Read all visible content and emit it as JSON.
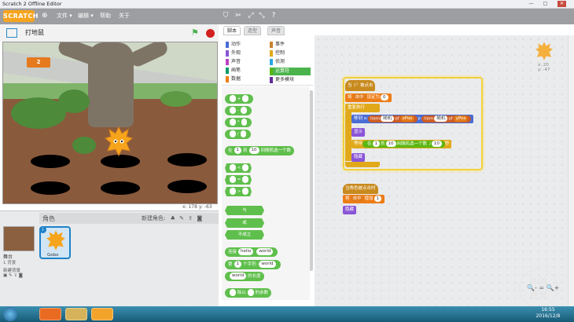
{
  "window": {
    "title": "Scratch 2 Offline Editor",
    "min": "—",
    "max": "□",
    "close": "✕"
  },
  "menubar": {
    "logo": "SCRATCH",
    "items": [
      "文件 ▾",
      "编辑 ▾",
      "帮助",
      "关于"
    ],
    "tools": [
      "duplicate-icon",
      "delete-icon",
      "grow-icon",
      "shrink-icon",
      "help-icon"
    ]
  },
  "stage": {
    "project_name": "打地鼠",
    "score": "2",
    "coords": "x: 178  y: -63"
  },
  "sprites": {
    "header": "角色",
    "new_sprite": "新建角色:",
    "stage_label": "舞台",
    "stage_sub": "1 背景",
    "new_backdrop": "新建背景",
    "sprite_name": "Gobo"
  },
  "tabs": [
    "脚本",
    "造型",
    "声音"
  ],
  "categories": [
    {
      "label": "动作",
      "color": "#4a6cd4"
    },
    {
      "label": "外观",
      "color": "#8a55d7"
    },
    {
      "label": "声音",
      "color": "#bb42c3"
    },
    {
      "label": "画笔",
      "color": "#0e9a6c"
    },
    {
      "label": "数据",
      "color": "#ee7d16"
    },
    {
      "label": "事件",
      "color": "#c88330"
    },
    {
      "label": "控制",
      "color": "#e1a91a"
    },
    {
      "label": "侦测",
      "color": "#2ca5e2"
    },
    {
      "label": "运算符",
      "color": "#5cb712",
      "selected": true
    },
    {
      "label": "更多模块",
      "color": "#632d99"
    }
  ],
  "palette": {
    "plus": "+",
    "minus": "-",
    "times": "*",
    "divide": "/",
    "random": {
      "pre": "在",
      "a": "1",
      "mid": "到",
      "b": "10",
      "post": "间随机选一个数"
    },
    "lt": "<",
    "eq": "=",
    "gt": ">",
    "and": "与",
    "or": "或",
    "not": "不成立",
    "join": {
      "pre": "连接",
      "a": "hello",
      "b": "world"
    },
    "letter": {
      "pre": "第",
      "a": "1",
      "mid": "个字符:",
      "b": "world"
    },
    "length": {
      "a": "world",
      "post": "的长度"
    },
    "mod": {
      "mid": "除以",
      "post": "的余数"
    }
  },
  "script1": {
    "hat": "当 🏳 被点击",
    "setvar": {
      "pre": "将",
      "var": "击中",
      "mid": "设定为",
      "val": "0"
    },
    "forever": "重复执行",
    "goto": {
      "pre": "移到 x:",
      "item1": "item",
      "dd1": "随机",
      "of1": "of",
      "list1": "xPos",
      "y": "y:",
      "item2": "item",
      "dd2": "随机",
      "of2": "of",
      "list2": "yPos"
    },
    "show": "显示",
    "wait": {
      "pre": "等待",
      "pre2": "在",
      "a": "1",
      "mid": "到",
      "b": "10",
      "post": "间随机选一个数",
      "div": "/",
      "c": "10",
      "sec": "秒"
    },
    "hide": "隐藏"
  },
  "script2": {
    "hat": "当角色被点击时",
    "change": {
      "pre": "将",
      "var": "击中",
      "mid": "增加",
      "val": "1"
    },
    "hide": "隐藏"
  },
  "sprite_corner": {
    "x": "x: 20",
    "y": "y: -47"
  },
  "zoom": {
    "out": "🔍-",
    "reset": "=",
    "in": "🔍+"
  },
  "watermark": "外滩\n教育",
  "taskbar": {
    "time": "16:55",
    "date": "2016/12/8"
  }
}
